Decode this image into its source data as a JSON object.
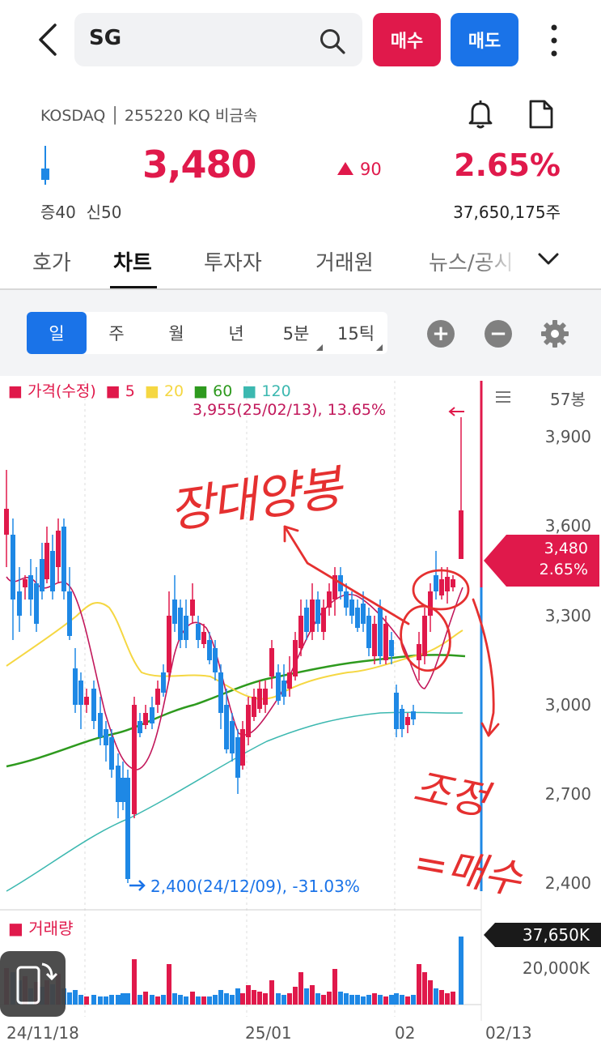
{
  "header": {
    "search_value": "SG",
    "buy_label": "매수",
    "sell_label": "매도"
  },
  "stock": {
    "exchange_info": "KOSDAQ │ 255220 KQ 비금속",
    "price": "3,480",
    "change": "90",
    "change_percent": "2.65%",
    "margin_info": "증40  신50",
    "volume": "37,650,175주"
  },
  "tabs": [
    {
      "label": "호가"
    },
    {
      "label": "차트"
    },
    {
      "label": "투자자"
    },
    {
      "label": "거래원"
    },
    {
      "label": "뉴스/공시"
    }
  ],
  "period_buttons": [
    {
      "label": "일"
    },
    {
      "label": "주"
    },
    {
      "label": "월"
    },
    {
      "label": "년"
    },
    {
      "label": "5분"
    },
    {
      "label": "15틱"
    }
  ],
  "chart": {
    "legend": {
      "price": "가격(수정)",
      "ma5": "5",
      "ma20": "20",
      "ma60": "60",
      "ma120": "120"
    },
    "bar_count": "57봉",
    "high_note": "3,955(25/02/13), 13.65%",
    "low_note": "2,400(24/12/09), -31.03%",
    "current_price": "3,480",
    "current_pct": "2.65%",
    "price_axis": [
      "3,900",
      "3,600",
      "3,300",
      "3,000",
      "2,700",
      "2,400"
    ],
    "volume_title": "거래량",
    "volume_tag": "37,650K",
    "volume_axis": "20,000K",
    "date_axis": [
      "24/11/18",
      "25/01",
      "02",
      "02/13"
    ],
    "colors": {
      "up": "#e0194b",
      "down": "#1e88e5",
      "ma5": "#c2185b",
      "ma20": "#f5d742",
      "ma60": "#2e9a1e",
      "ma120": "#3cb8b0"
    }
  },
  "annotations": {
    "top_text": "장대양봉",
    "bottom_text_1": "조정",
    "bottom_text_2": "=매수"
  }
}
